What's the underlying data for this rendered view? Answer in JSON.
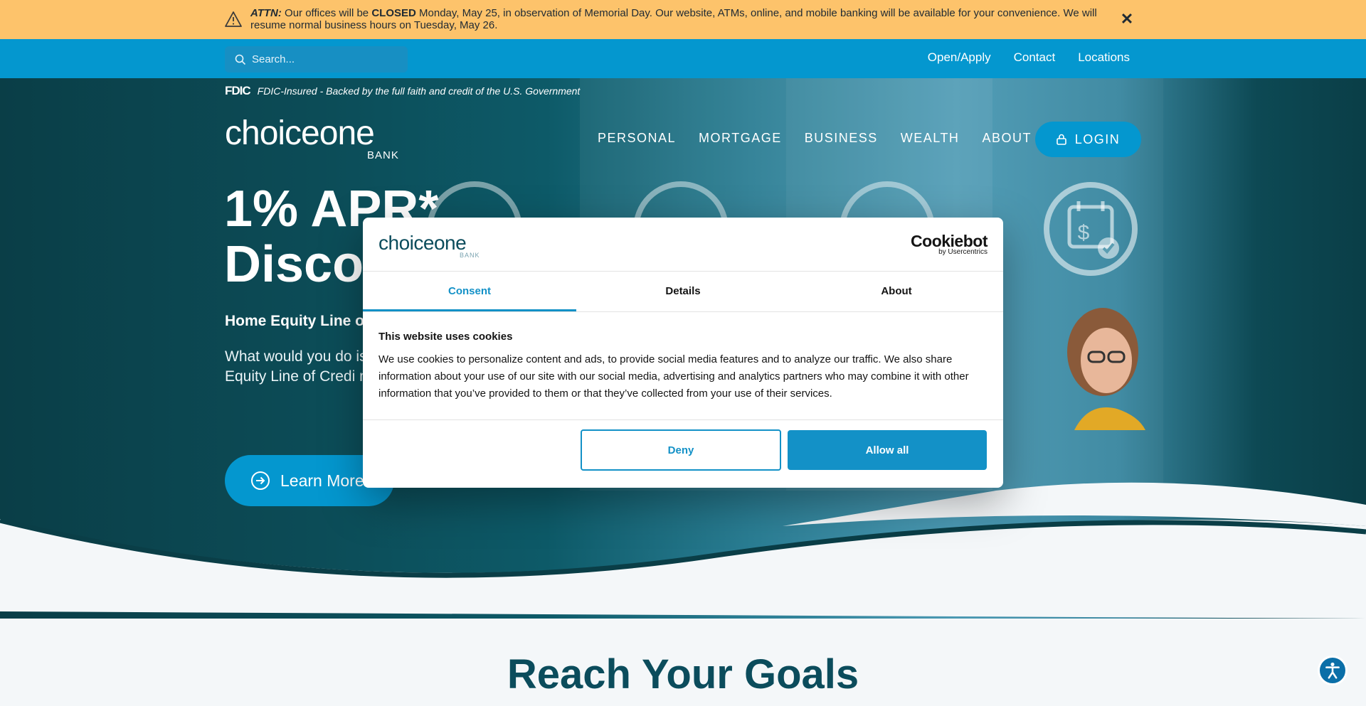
{
  "alert": {
    "attn_label": "ATTN:",
    "text_a": " Our offices will be ",
    "closed": "CLOSED",
    "text_b": " Monday, May 25, in observation of Memorial Day. Our website, ATMs, online, and mobile banking will be available for your convenience. We will resume normal business hours on Tuesday, May 26.",
    "close_glyph": "✕",
    "icon": "warning-icon",
    "bg_color": "#fdc36b"
  },
  "utility": {
    "search_placeholder": "Search...",
    "links": [
      "Open/Apply",
      "Contact",
      "Locations"
    ],
    "bg_color": "#0497cf"
  },
  "header": {
    "fdic_mark": "FDIC",
    "fdic_text": "FDIC-Insured - Backed by the full faith and credit of the U.S. Government",
    "logo_word": "choiceone",
    "logo_sub": "BANK",
    "nav": [
      "PERSONAL",
      "MORTGAGE",
      "BUSINESS",
      "WEALTH",
      "ABOUT"
    ],
    "login_label": "LOGIN"
  },
  "hero": {
    "headline_line1": "1% APR*",
    "headline_line2": "Disco",
    "subheading": "Home Equity Line o",
    "paragraph": "What would you do is your biggest asse Equity Line of Credi most of it!",
    "cta_label": "Learn More"
  },
  "section": {
    "title": "Reach Your Goals"
  },
  "cookie_dialog": {
    "logo_word": "choiceone",
    "logo_sub": "BANK",
    "provider": "Cookiebot",
    "provider_sub": "by Usercentrics",
    "tabs": [
      "Consent",
      "Details",
      "About"
    ],
    "active_tab": "Consent",
    "heading": "This website uses cookies",
    "body": "We use cookies to personalize content and ads, to provide social media features and to analyze our traffic. We also share information about your use of our site with our social media, advertising and analytics partners who may combine it with other information that you’ve provided to them or that they’ve collected from your use of their services.",
    "deny_label": "Deny",
    "allow_label": "Allow all",
    "accent_color": "#1391c7"
  }
}
